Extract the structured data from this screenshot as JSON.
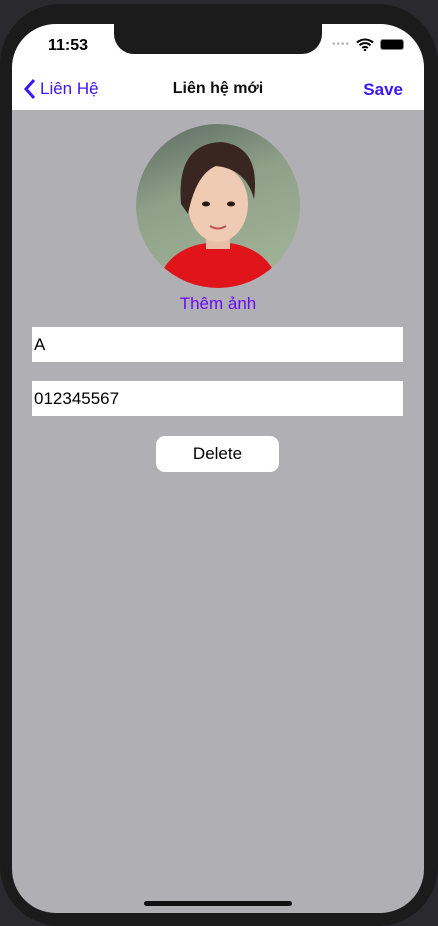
{
  "status": {
    "time": "11:53"
  },
  "nav": {
    "back_label": "Liên Hệ",
    "title": "Liên hệ mới",
    "save_label": "Save"
  },
  "main": {
    "add_photo_label": "Thêm ảnh",
    "name_value": "A",
    "phone_value": "012345567",
    "delete_label": "Delete"
  },
  "colors": {
    "accent": "#3a17f5",
    "add_photo": "#6a0af5",
    "background": "#b0afb4"
  }
}
